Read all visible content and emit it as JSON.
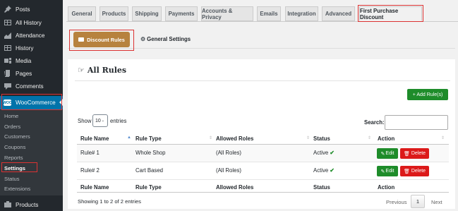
{
  "sidebar": {
    "items": [
      {
        "label": "Posts",
        "icon": "pin-icon"
      },
      {
        "label": "All History",
        "icon": "table-icon"
      },
      {
        "label": "Attendance",
        "icon": "chart-icon"
      },
      {
        "label": "History",
        "icon": "table-icon"
      },
      {
        "label": "Media",
        "icon": "media-icon"
      },
      {
        "label": "Pages",
        "icon": "pages-icon"
      },
      {
        "label": "Comments",
        "icon": "comment-icon"
      }
    ],
    "woocommerce": {
      "label": "WooCommerce",
      "badge": "WOO"
    },
    "submenu": [
      "Home",
      "Orders",
      "Customers",
      "Coupons",
      "Reports",
      "Settings",
      "Status",
      "Extensions"
    ],
    "active_submenu": "Settings",
    "products": {
      "label": "Products",
      "icon": "products-icon"
    }
  },
  "tabs": [
    "General",
    "Products",
    "Shipping",
    "Payments",
    "Accounts & Privacy",
    "Emails",
    "Integration",
    "Advanced",
    "First Purchase Discount"
  ],
  "active_tab": "First Purchase Discount",
  "subtabs": {
    "discount_rules": "Discount Rules",
    "general_settings": "General Settings"
  },
  "panel": {
    "title": "All Rules",
    "add_button": "+ Add Rule(s)",
    "show_label": "Show",
    "entries_value": "10",
    "entries_label": "entries",
    "search_label": "Search:",
    "search_value": ""
  },
  "table": {
    "columns": [
      "Rule Name",
      "Rule Type",
      "Allowed Roles",
      "Status",
      "Action"
    ],
    "rows": [
      {
        "name": "Rule# 1",
        "type": "Whole Shop",
        "roles": "(All Roles)",
        "status": "Active"
      },
      {
        "name": "Rule# 2",
        "type": "Cart Based",
        "roles": "(All Roles)",
        "status": "Active"
      }
    ],
    "edit_label": "Edit",
    "delete_label": "Delete"
  },
  "footer": {
    "info": "Showing 1 to 2 of 2 entries",
    "previous": "Previous",
    "page": "1",
    "next": "Next"
  },
  "colors": {
    "woo_blue": "#0073aa",
    "discount_btn": "#b7823e",
    "green": "#1e8c2a",
    "red": "#dc1a1a",
    "highlight": "#dc3232"
  }
}
